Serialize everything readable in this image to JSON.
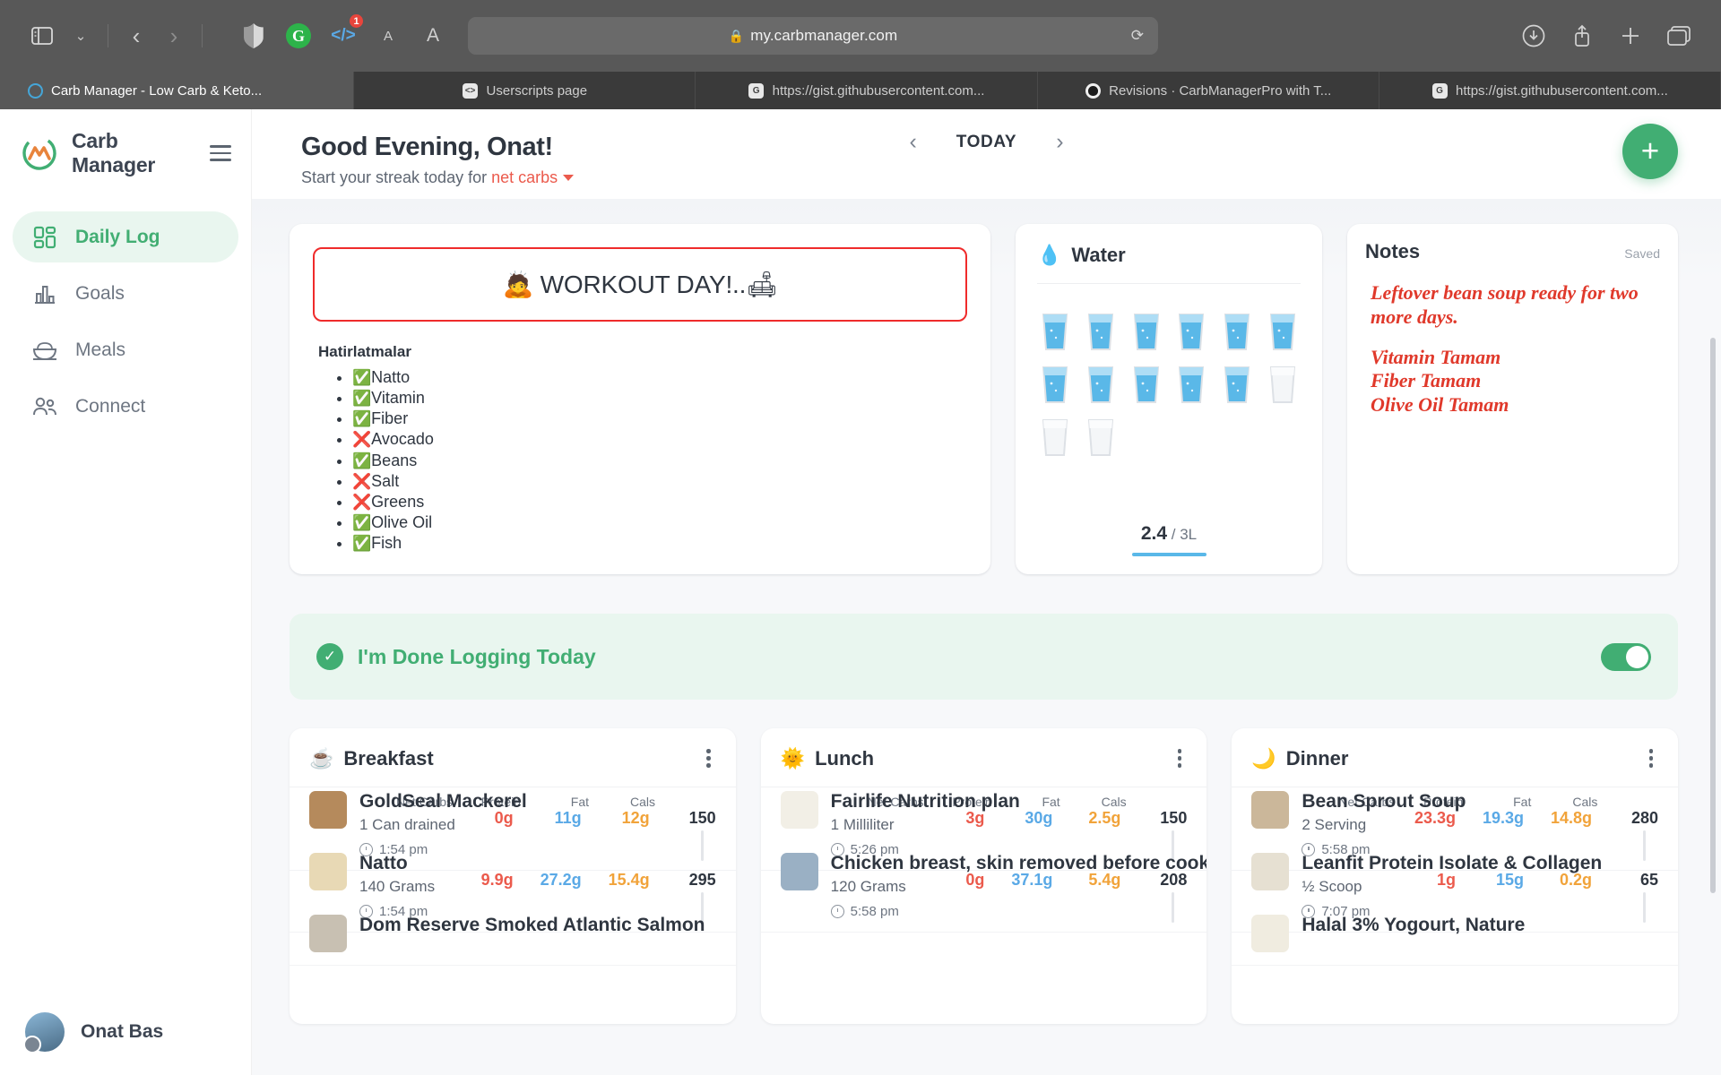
{
  "browser": {
    "url": "my.carbmanager.com",
    "lock_icon": "lock-icon",
    "reload_icon": "reload-icon",
    "extensions": [
      {
        "name": "shield-extension-icon",
        "badge": ""
      },
      {
        "name": "grammarly-extension-icon",
        "label": "G",
        "badge": ""
      },
      {
        "name": "userscript-extension-icon",
        "label": "</>",
        "badge": "1"
      }
    ],
    "reader_small_label": "A",
    "reader_large_label": "A",
    "tabs": [
      {
        "label": "Carb Manager - Low Carb & Keto...",
        "favicon": "carbmanager-favicon",
        "active": true
      },
      {
        "label": "Userscripts page",
        "favicon": "userscript-favicon",
        "active": false
      },
      {
        "label": "https://gist.githubusercontent.com...",
        "favicon": "gist-favicon",
        "active": false
      },
      {
        "label": "Revisions · CarbManagerPro with T...",
        "favicon": "github-favicon",
        "active": false
      },
      {
        "label": "https://gist.githubusercontent.com...",
        "favicon": "gist-favicon",
        "active": false
      }
    ]
  },
  "sidebar": {
    "brand": "Carb Manager",
    "menu_icon": "hamburger-icon",
    "items": [
      {
        "label": "Daily Log",
        "icon": "dashboard-icon",
        "active": true
      },
      {
        "label": "Goals",
        "icon": "bar-chart-icon",
        "active": false
      },
      {
        "label": "Meals",
        "icon": "bowl-icon",
        "active": false
      },
      {
        "label": "Connect",
        "icon": "people-icon",
        "active": false
      }
    ],
    "user": {
      "name": "Onat Bas",
      "avatar": "user-avatar"
    }
  },
  "header": {
    "greeting": "Good Evening, Onat!",
    "subtitle_prefix": "Start your streak today for ",
    "subtitle_link": "net carbs",
    "day_label": "TODAY",
    "prev_icon": "chevron-left-icon",
    "next_icon": "chevron-right-icon",
    "add_label": "+"
  },
  "workout_card": {
    "banner": "🙇 WORKOUT DAY!..🛋",
    "reminders_title": "Hatirlatmalar",
    "reminders": [
      {
        "mark": "✅",
        "label": "Natto"
      },
      {
        "mark": "✅",
        "label": "Vitamin"
      },
      {
        "mark": "✅",
        "label": "Fiber"
      },
      {
        "mark": "❌",
        "label": "Avocado"
      },
      {
        "mark": "✅",
        "label": "Beans"
      },
      {
        "mark": "❌",
        "label": "Salt"
      },
      {
        "mark": "❌",
        "label": "Greens"
      },
      {
        "mark": "✅",
        "label": "Olive Oil"
      },
      {
        "mark": "✅",
        "label": "Fish"
      }
    ]
  },
  "water_card": {
    "title": "Water",
    "emoji": "💧",
    "amount": "2.4",
    "unit": " / 3L",
    "glasses_total": 14,
    "glasses_filled": 11
  },
  "notes_card": {
    "title": "Notes",
    "status": "Saved",
    "paragraphs": [
      "Leftover bean soup ready for two more days.",
      "Vitamin Tamam\nFiber Tamam\nOlive Oil Tamam"
    ]
  },
  "done_bar": {
    "label": "I'm Done Logging Today",
    "checked": true
  },
  "meal_columns": {
    "headers": [
      "Net Carbs",
      "Protein",
      "Fat",
      "Cals"
    ],
    "meals": [
      {
        "title": "Breakfast",
        "emoji": "☕",
        "menu_icon": "kebab-menu-icon",
        "items": [
          {
            "name": "GoldSeal Mackerel",
            "serving": "1 Can drained",
            "time": "1:54 pm",
            "net_carbs": "0g",
            "protein": "11g",
            "fat": "12g",
            "cals": "150"
          },
          {
            "name": "Natto",
            "serving": "140 Grams",
            "time": "1:54 pm",
            "net_carbs": "9.9g",
            "protein": "27.2g",
            "fat": "15.4g",
            "cals": "295"
          },
          {
            "name": "Dom Reserve Smoked Atlantic Salmon",
            "serving": "",
            "time": "",
            "net_carbs": "",
            "protein": "",
            "fat": "",
            "cals": ""
          }
        ]
      },
      {
        "title": "Lunch",
        "emoji": "🌞",
        "menu_icon": "kebab-menu-icon",
        "items": [
          {
            "name": "Fairlife Nutrition plan",
            "serving": "1 Milliliter",
            "time": "5:26 pm",
            "net_carbs": "3g",
            "protein": "30g",
            "fat": "2.5g",
            "cals": "150"
          },
          {
            "name": "Chicken breast, skin removed before cooking",
            "serving": "120 Grams",
            "time": "5:58 pm",
            "net_carbs": "0g",
            "protein": "37.1g",
            "fat": "5.4g",
            "cals": "208"
          }
        ]
      },
      {
        "title": "Dinner",
        "emoji": "🌙",
        "menu_icon": "kebab-menu-icon",
        "items": [
          {
            "name": "Bean Sprout Soup",
            "serving": "2 Serving",
            "time": "5:58 pm",
            "net_carbs": "23.3g",
            "protein": "19.3g",
            "fat": "14.8g",
            "cals": "280"
          },
          {
            "name": "Leanfit Protein Isolate & Collagen",
            "serving": "½ Scoop",
            "time": "7:07 pm",
            "net_carbs": "1g",
            "protein": "15g",
            "fat": "0.2g",
            "cals": "65"
          },
          {
            "name": "Halal 3% Yogourt, Nature",
            "serving": "",
            "time": "",
            "net_carbs": "",
            "protein": "",
            "fat": "",
            "cals": ""
          }
        ]
      }
    ]
  },
  "colors": {
    "brand_green": "#41ae73",
    "net_carbs": "#eb5a4c",
    "protein": "#5aa9e6",
    "fat": "#f1a33a",
    "notes_red": "#e0392b"
  }
}
